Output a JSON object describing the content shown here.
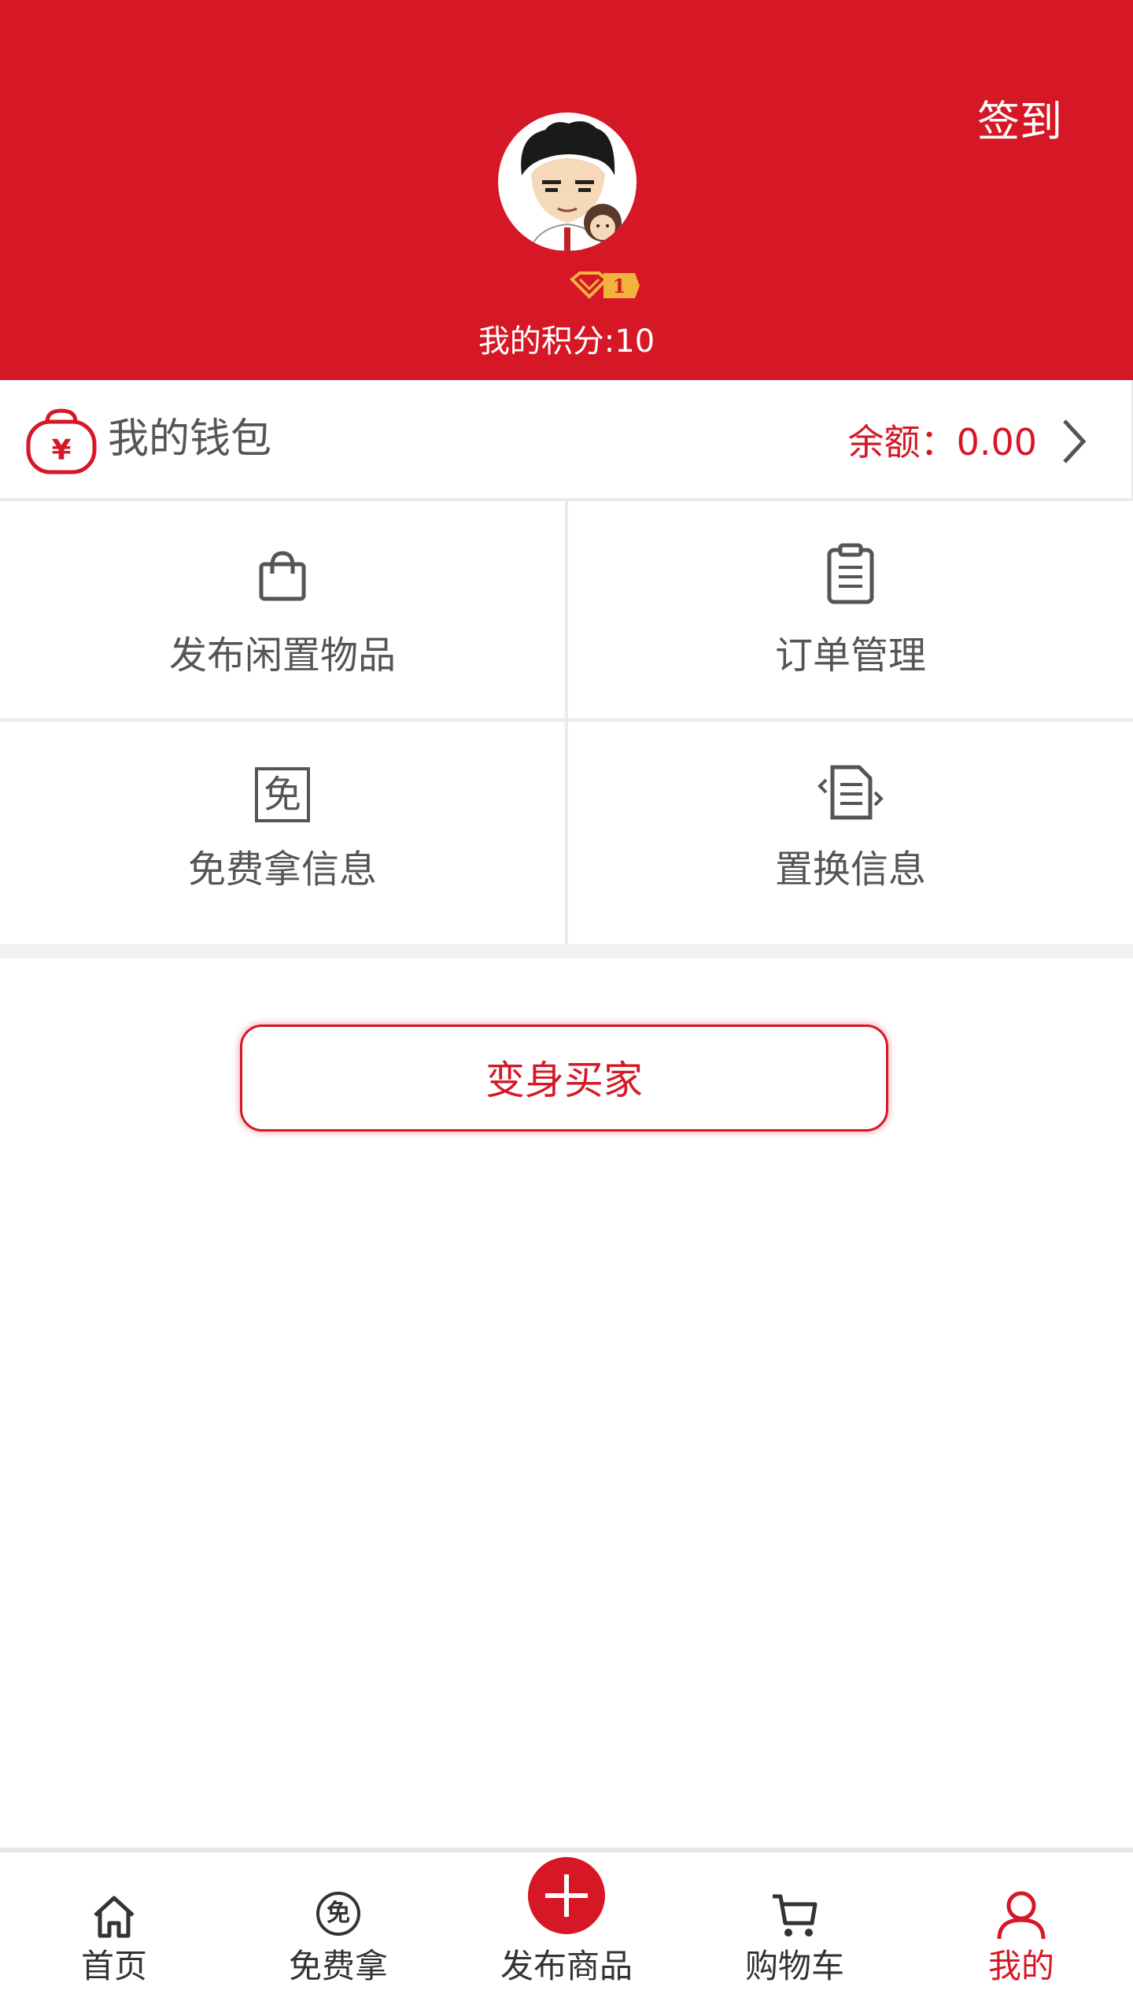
{
  "header": {
    "signin_label": "签到",
    "level": "1",
    "points_text": "我的积分:10"
  },
  "wallet": {
    "title": "我的钱包",
    "balance_text": "余额：0.00"
  },
  "menu": [
    {
      "label": "发布闲置物品",
      "icon": "shopping-bag-icon"
    },
    {
      "label": "订单管理",
      "icon": "clipboard-icon"
    },
    {
      "label": "免费拿信息",
      "icon": "free-icon",
      "icon_char": "免"
    },
    {
      "label": "置换信息",
      "icon": "exchange-document-icon"
    }
  ],
  "buyer_button": "变身买家",
  "bottom_nav": [
    {
      "label": "首页",
      "icon": "home-icon"
    },
    {
      "label": "免费拿",
      "icon": "free-circle-icon",
      "icon_char": "免"
    },
    {
      "label": "发布商品",
      "icon": "plus-icon"
    },
    {
      "label": "购物车",
      "icon": "cart-icon"
    },
    {
      "label": "我的",
      "icon": "user-icon",
      "active": true
    }
  ],
  "colors": {
    "primary": "#d61726",
    "text": "#555555",
    "divider": "#ececec"
  }
}
